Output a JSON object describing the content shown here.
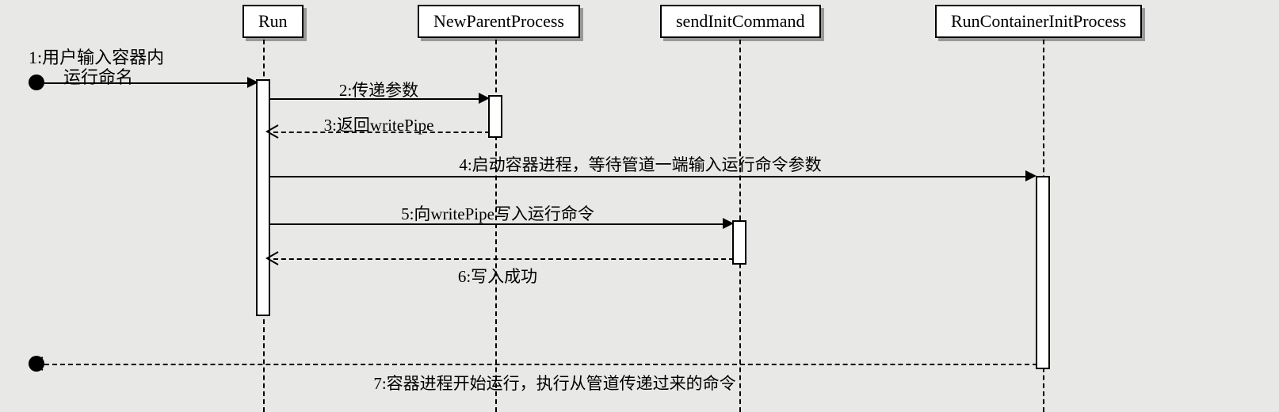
{
  "participants": {
    "run": "Run",
    "new_parent": "NewParentProcess",
    "send_init": "sendInitCommand",
    "run_container": "RunContainerInitProcess"
  },
  "actor": {
    "label_line1": "1:用户输入容器内",
    "label_line2": "运行命名"
  },
  "messages": {
    "m2": "2:传递参数",
    "m3": "3:返回writePipe",
    "m4": "4:启动容器进程，等待管道一端输入运行命令参数",
    "m5": "5:向writePipe写入运行命令",
    "m6": "6:写入成功",
    "m7": "7:容器进程开始运行，执行从管道传递过来的命令"
  },
  "chart_data": {
    "type": "sequence_diagram",
    "actor": "用户 (User)",
    "participants": [
      "Run",
      "NewParentProcess",
      "sendInitCommand",
      "RunContainerInitProcess"
    ],
    "messages": [
      {
        "seq": 1,
        "from": "用户",
        "to": "Run",
        "text": "用户输入容器内运行命名",
        "kind": "sync"
      },
      {
        "seq": 2,
        "from": "Run",
        "to": "NewParentProcess",
        "text": "传递参数",
        "kind": "sync"
      },
      {
        "seq": 3,
        "from": "NewParentProcess",
        "to": "Run",
        "text": "返回writePipe",
        "kind": "return"
      },
      {
        "seq": 4,
        "from": "Run",
        "to": "RunContainerInitProcess",
        "text": "启动容器进程，等待管道一端输入运行命令参数",
        "kind": "sync"
      },
      {
        "seq": 5,
        "from": "Run",
        "to": "sendInitCommand",
        "text": "向writePipe写入运行命令",
        "kind": "sync"
      },
      {
        "seq": 6,
        "from": "sendInitCommand",
        "to": "Run",
        "text": "写入成功",
        "kind": "return"
      },
      {
        "seq": 7,
        "from": "RunContainerInitProcess",
        "to": "用户",
        "text": "容器进程开始运行，执行从管道传递过来的命令",
        "kind": "return"
      }
    ]
  }
}
